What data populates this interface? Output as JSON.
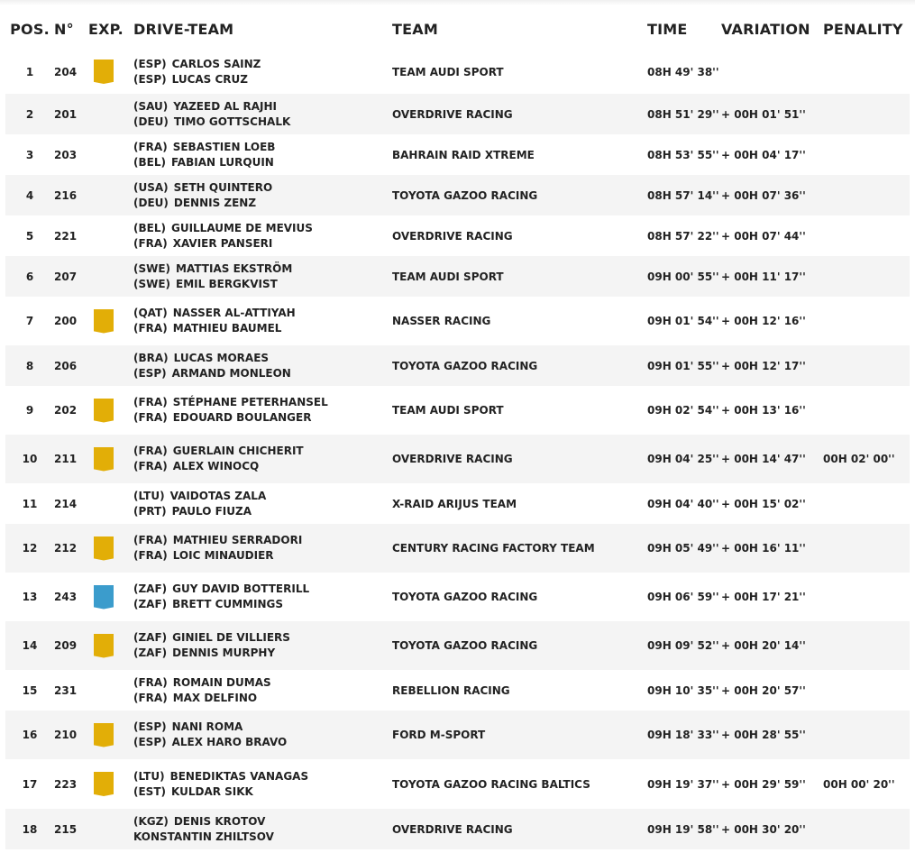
{
  "colors": {
    "expert_badge": "#e2ae07",
    "rookie_badge": "#3b9ccc",
    "row_alt_bg": "#f4f4f4"
  },
  "headers": {
    "pos": "POS.",
    "num": "N°",
    "exp": "EXP.",
    "drive_team": "DRIVE-TEAM",
    "team": "TEAM",
    "time": "TIME",
    "variation": "VARIATION",
    "penality": "PENALITY"
  },
  "rows": [
    {
      "pos": "1",
      "num": "204",
      "badge": "gold",
      "d1": {
        "nat": "(ESP)",
        "name": "CARLOS SAINZ"
      },
      "d2": {
        "nat": "(ESP)",
        "name": "LUCAS CRUZ"
      },
      "team": "TEAM AUDI SPORT",
      "time": "08H 49' 38''",
      "variation": "",
      "penality": ""
    },
    {
      "pos": "2",
      "num": "201",
      "badge": "",
      "d1": {
        "nat": "(SAU)",
        "name": "YAZEED AL RAJHI"
      },
      "d2": {
        "nat": "(DEU)",
        "name": "TIMO GOTTSCHALK"
      },
      "team": "OVERDRIVE RACING",
      "time": "08H 51' 29''",
      "variation": "+ 00H 01' 51''",
      "penality": ""
    },
    {
      "pos": "3",
      "num": "203",
      "badge": "",
      "d1": {
        "nat": "(FRA)",
        "name": "SEBASTIEN LOEB"
      },
      "d2": {
        "nat": "(BEL)",
        "name": "FABIAN LURQUIN"
      },
      "team": "BAHRAIN RAID XTREME",
      "time": "08H 53' 55''",
      "variation": "+ 00H 04' 17''",
      "penality": ""
    },
    {
      "pos": "4",
      "num": "216",
      "badge": "",
      "d1": {
        "nat": "(USA)",
        "name": "SETH QUINTERO"
      },
      "d2": {
        "nat": "(DEU)",
        "name": "DENNIS ZENZ"
      },
      "team": "TOYOTA GAZOO RACING",
      "time": "08H 57' 14''",
      "variation": "+ 00H 07' 36''",
      "penality": ""
    },
    {
      "pos": "5",
      "num": "221",
      "badge": "",
      "d1": {
        "nat": "(BEL)",
        "name": "GUILLAUME DE MEVIUS"
      },
      "d2": {
        "nat": "(FRA)",
        "name": "XAVIER PANSERI"
      },
      "team": "OVERDRIVE RACING",
      "time": "08H 57' 22''",
      "variation": "+ 00H 07' 44''",
      "penality": ""
    },
    {
      "pos": "6",
      "num": "207",
      "badge": "",
      "d1": {
        "nat": "(SWE)",
        "name": "MATTIAS EKSTRÖM"
      },
      "d2": {
        "nat": "(SWE)",
        "name": "EMIL BERGKVIST"
      },
      "team": "TEAM AUDI SPORT",
      "time": "09H 00' 55''",
      "variation": "+ 00H 11' 17''",
      "penality": ""
    },
    {
      "pos": "7",
      "num": "200",
      "badge": "gold",
      "d1": {
        "nat": "(QAT)",
        "name": "NASSER AL-ATTIYAH"
      },
      "d2": {
        "nat": "(FRA)",
        "name": "MATHIEU BAUMEL"
      },
      "team": "NASSER RACING",
      "time": "09H 01' 54''",
      "variation": "+ 00H 12' 16''",
      "penality": ""
    },
    {
      "pos": "8",
      "num": "206",
      "badge": "",
      "d1": {
        "nat": "(BRA)",
        "name": "LUCAS MORAES"
      },
      "d2": {
        "nat": "(ESP)",
        "name": "ARMAND MONLEON"
      },
      "team": "TOYOTA GAZOO RACING",
      "time": "09H 01' 55''",
      "variation": "+ 00H 12' 17''",
      "penality": ""
    },
    {
      "pos": "9",
      "num": "202",
      "badge": "gold",
      "d1": {
        "nat": "(FRA)",
        "name": "STÉPHANE PETERHANSEL"
      },
      "d2": {
        "nat": "(FRA)",
        "name": "EDOUARD BOULANGER"
      },
      "team": "TEAM AUDI SPORT",
      "time": "09H 02' 54''",
      "variation": "+ 00H 13' 16''",
      "penality": ""
    },
    {
      "pos": "10",
      "num": "211",
      "badge": "gold",
      "d1": {
        "nat": "(FRA)",
        "name": "GUERLAIN CHICHERIT"
      },
      "d2": {
        "nat": "(FRA)",
        "name": "ALEX WINOCQ"
      },
      "team": "OVERDRIVE RACING",
      "time": "09H 04' 25''",
      "variation": "+ 00H 14' 47''",
      "penality": "00H 02' 00''"
    },
    {
      "pos": "11",
      "num": "214",
      "badge": "",
      "d1": {
        "nat": "(LTU)",
        "name": "VAIDOTAS ZALA"
      },
      "d2": {
        "nat": "(PRT)",
        "name": "PAULO FIUZA"
      },
      "team": "X-RAID ARIJUS TEAM",
      "time": "09H 04' 40''",
      "variation": "+ 00H 15' 02''",
      "penality": ""
    },
    {
      "pos": "12",
      "num": "212",
      "badge": "gold",
      "d1": {
        "nat": "(FRA)",
        "name": "MATHIEU SERRADORI"
      },
      "d2": {
        "nat": "(FRA)",
        "name": "LOIC MINAUDIER"
      },
      "team": "CENTURY RACING FACTORY TEAM",
      "time": "09H 05' 49''",
      "variation": "+ 00H 16' 11''",
      "penality": ""
    },
    {
      "pos": "13",
      "num": "243",
      "badge": "blue",
      "d1": {
        "nat": "(ZAF)",
        "name": "GUY DAVID BOTTERILL"
      },
      "d2": {
        "nat": "(ZAF)",
        "name": "BRETT CUMMINGS"
      },
      "team": "TOYOTA GAZOO RACING",
      "time": "09H 06' 59''",
      "variation": "+ 00H 17' 21''",
      "penality": ""
    },
    {
      "pos": "14",
      "num": "209",
      "badge": "gold",
      "d1": {
        "nat": "(ZAF)",
        "name": "GINIEL DE VILLIERS"
      },
      "d2": {
        "nat": "(ZAF)",
        "name": "DENNIS MURPHY"
      },
      "team": "TOYOTA GAZOO RACING",
      "time": "09H 09' 52''",
      "variation": "+ 00H 20' 14''",
      "penality": ""
    },
    {
      "pos": "15",
      "num": "231",
      "badge": "",
      "d1": {
        "nat": "(FRA)",
        "name": "ROMAIN DUMAS"
      },
      "d2": {
        "nat": "(FRA)",
        "name": "MAX DELFINO"
      },
      "team": "REBELLION RACING",
      "time": "09H 10' 35''",
      "variation": "+ 00H 20' 57''",
      "penality": ""
    },
    {
      "pos": "16",
      "num": "210",
      "badge": "gold",
      "d1": {
        "nat": "(ESP)",
        "name": "NANI ROMA"
      },
      "d2": {
        "nat": "(ESP)",
        "name": "ALEX HARO BRAVO"
      },
      "team": "FORD M-SPORT",
      "time": "09H 18' 33''",
      "variation": "+ 00H 28' 55''",
      "penality": ""
    },
    {
      "pos": "17",
      "num": "223",
      "badge": "gold",
      "d1": {
        "nat": "(LTU)",
        "name": "BENEDIKTAS VANAGAS"
      },
      "d2": {
        "nat": "(EST)",
        "name": "KULDAR SIKK"
      },
      "team": "TOYOTA GAZOO RACING BALTICS",
      "time": "09H 19' 37''",
      "variation": "+ 00H 29' 59''",
      "penality": "00H 00' 20''"
    },
    {
      "pos": "18",
      "num": "215",
      "badge": "",
      "d1": {
        "nat": "(KGZ)",
        "name": "DENIS KROTOV"
      },
      "d2": {
        "nat": "",
        "name": "KONSTANTIN ZHILTSOV"
      },
      "team": "OVERDRIVE RACING",
      "time": "09H 19' 58''",
      "variation": "+ 00H 30' 20''",
      "penality": ""
    }
  ]
}
